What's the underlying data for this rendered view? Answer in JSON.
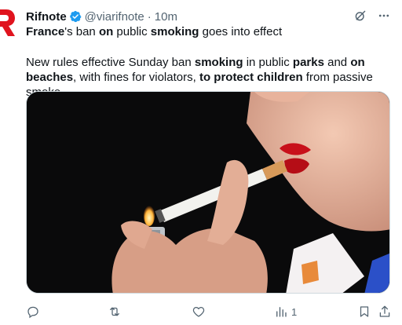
{
  "post": {
    "author": {
      "name": "Rifnote",
      "handle": "@viarifnote",
      "separator": "·",
      "time": "10m"
    },
    "headline": {
      "parts": [
        "France",
        "'s ban ",
        "on",
        " public ",
        "smoking",
        " goes into effect"
      ]
    },
    "body": {
      "parts": [
        "New rules effective Sunday ban ",
        "smoking",
        " in public ",
        "parks",
        " and ",
        "on beaches",
        ", with fines for violators, ",
        "to protect children",
        " from passive smoke."
      ]
    },
    "image": {
      "subject": "person lighting a cigarette with a blue lighter"
    },
    "actions": {
      "views_count": "1"
    },
    "icons": {
      "avatar": "rifnote-logo-icon",
      "verified": "verified-badge-icon",
      "grok": "grok-icon",
      "more": "more-icon",
      "reply": "reply-icon",
      "retweet": "retweet-icon",
      "like": "like-icon",
      "views": "views-icon",
      "bookmark": "bookmark-icon",
      "share": "share-icon"
    },
    "colors": {
      "brand": "#e0141e",
      "verified": "#1d9bf0",
      "muted": "#536471",
      "text": "#0f1419"
    }
  }
}
